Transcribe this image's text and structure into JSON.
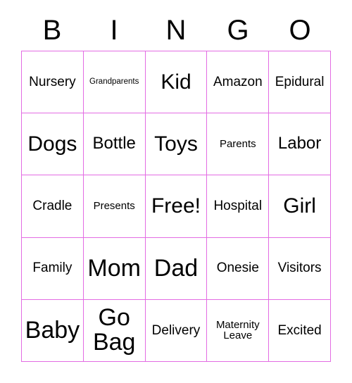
{
  "card": {
    "title_letters": [
      "B",
      "I",
      "N",
      "G",
      "O"
    ],
    "border_color": "#e36ce3",
    "text_color": "#000000",
    "background_color": "#ffffff",
    "grid_size": "5x5"
  },
  "rows": [
    [
      {
        "label": "Nursery",
        "size": "m"
      },
      {
        "label": "Grandparents",
        "size": "xs"
      },
      {
        "label": "Kid",
        "size": "xl"
      },
      {
        "label": "Amazon",
        "size": "m"
      },
      {
        "label": "Epidural",
        "size": "m"
      }
    ],
    [
      {
        "label": "Dogs",
        "size": "xl"
      },
      {
        "label": "Bottle",
        "size": "l"
      },
      {
        "label": "Toys",
        "size": "xl"
      },
      {
        "label": "Parents",
        "size": "s"
      },
      {
        "label": "Labor",
        "size": "l"
      }
    ],
    [
      {
        "label": "Cradle",
        "size": "m"
      },
      {
        "label": "Presents",
        "size": "s"
      },
      {
        "label": "Free!",
        "size": "xl"
      },
      {
        "label": "Hospital",
        "size": "m"
      },
      {
        "label": "Girl",
        "size": "xl"
      }
    ],
    [
      {
        "label": "Family",
        "size": "m"
      },
      {
        "label": "Mom",
        "size": "xxl"
      },
      {
        "label": "Dad",
        "size": "xxl"
      },
      {
        "label": "Onesie",
        "size": "m"
      },
      {
        "label": "Visitors",
        "size": "m"
      }
    ],
    [
      {
        "label": "Baby",
        "size": "xxl"
      },
      {
        "label": "Go\nBag",
        "size": "xxl"
      },
      {
        "label": "Delivery",
        "size": "m"
      },
      {
        "label": "Maternity\nLeave",
        "size": "s"
      },
      {
        "label": "Excited",
        "size": "m"
      }
    ]
  ]
}
